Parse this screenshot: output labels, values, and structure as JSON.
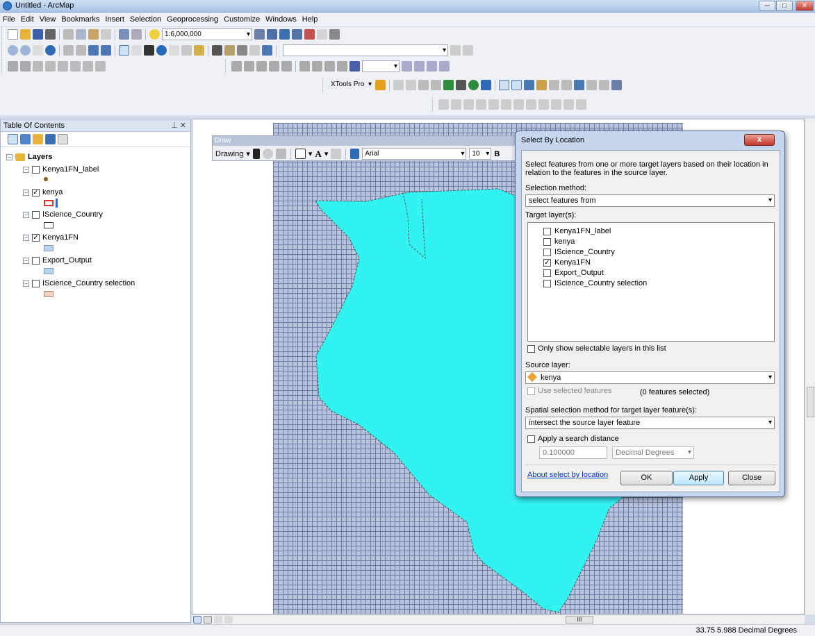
{
  "window": {
    "title": "Untitled - ArcMap"
  },
  "menu": [
    "File",
    "Edit",
    "View",
    "Bookmarks",
    "Insert",
    "Selection",
    "Geoprocessing",
    "Customize",
    "Windows",
    "Help"
  ],
  "toolbar": {
    "scale": "1:6,000,000",
    "xtools_label": "XTools Pro"
  },
  "toc": {
    "title": "Table Of Contents",
    "root": "Layers",
    "layers": [
      {
        "name": "Kenya1FN_label",
        "checked": false
      },
      {
        "name": "kenya",
        "checked": true
      },
      {
        "name": "IScience_Country",
        "checked": false
      },
      {
        "name": "Kenya1FN",
        "checked": true
      },
      {
        "name": "Export_Output",
        "checked": false
      },
      {
        "name": "IScience_Country selection",
        "checked": false
      }
    ]
  },
  "draw": {
    "title": "Draw",
    "drawing_label": "Drawing",
    "font": "Arial",
    "size": "10",
    "bold": "B"
  },
  "dialog": {
    "title": "Select By Location",
    "close": "x",
    "description": "Select features from one or more target layers based on their location in relation to the features in the source layer.",
    "selection_method_label": "Selection method:",
    "selection_method": "select features from",
    "target_label": "Target layer(s):",
    "targets": [
      {
        "name": "Kenya1FN_label",
        "checked": false
      },
      {
        "name": "kenya",
        "checked": false
      },
      {
        "name": "IScience_Country",
        "checked": false
      },
      {
        "name": "Kenya1FN",
        "checked": true
      },
      {
        "name": "Export_Output",
        "checked": false
      },
      {
        "name": "IScience_Country selection",
        "checked": false
      }
    ],
    "only_selectable": "Only show selectable layers in this list",
    "source_label": "Source layer:",
    "source_layer": "kenya",
    "use_selected": "Use selected features",
    "features_selected": "(0 features selected)",
    "spatial_method_label": "Spatial selection method for target layer feature(s):",
    "spatial_method": "intersect the source layer feature",
    "apply_distance": "Apply a search distance",
    "distance_value": "0.100000",
    "distance_units": "Decimal Degrees",
    "about_link": "About select by location",
    "ok": "OK",
    "apply": "Apply",
    "close_btn": "Close"
  },
  "hscroll": {
    "thumb": "III"
  },
  "status": {
    "coordinates": "33.75  5.988 Decimal Degrees"
  },
  "colors": {
    "kenya_fill": "#33f2f2",
    "grid": "#b8c4dc",
    "dialog_frame": "#c5d6ee"
  }
}
